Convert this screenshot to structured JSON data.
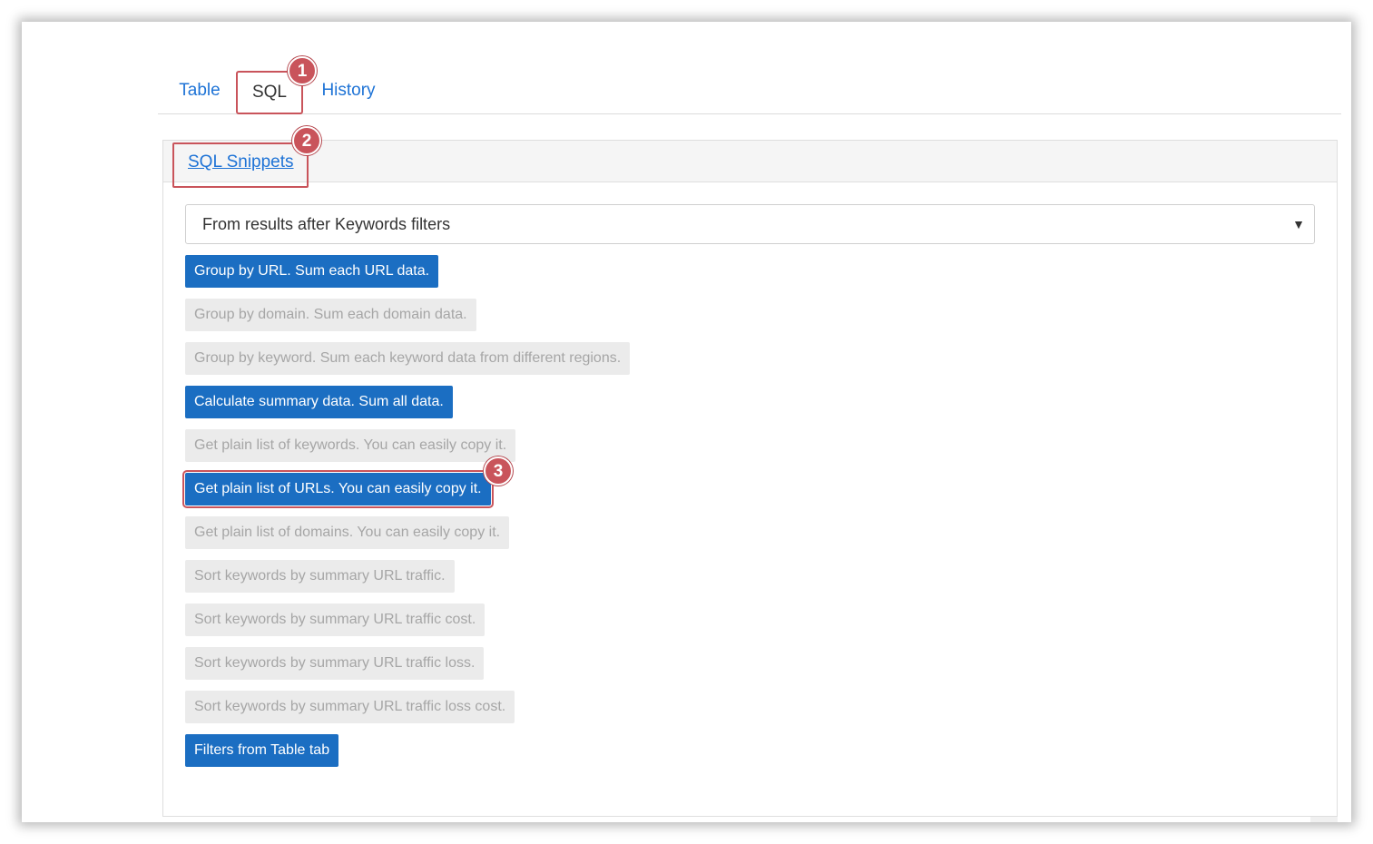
{
  "tabs": {
    "table": "Table",
    "sql": "SQL",
    "history": "History"
  },
  "callouts": {
    "one": "1",
    "two": "2",
    "three": "3"
  },
  "panel": {
    "snippets_link": "SQL Snippets",
    "source_select": {
      "value": "From results after Keywords filters",
      "arrow_icon": "triangle-down-icon"
    }
  },
  "snippets": [
    {
      "label": "Group by URL. Sum each URL data.",
      "state": "active"
    },
    {
      "label": "Group by domain. Sum each domain data.",
      "state": "inactive"
    },
    {
      "label": "Group by keyword. Sum each keyword data from different regions.",
      "state": "inactive"
    },
    {
      "label": "Calculate summary data. Sum all data.",
      "state": "active"
    },
    {
      "label": "Get plain list of keywords. You can easily copy it.",
      "state": "inactive"
    },
    {
      "label": "Get plain list of URLs. You can easily copy it.",
      "state": "active"
    },
    {
      "label": "Get plain list of domains. You can easily copy it.",
      "state": "inactive"
    },
    {
      "label": "Sort keywords by summary URL traffic.",
      "state": "inactive"
    },
    {
      "label": "Sort keywords by summary URL traffic cost.",
      "state": "inactive"
    },
    {
      "label": "Sort keywords by summary URL traffic loss.",
      "state": "inactive"
    },
    {
      "label": "Sort keywords by summary URL traffic loss cost.",
      "state": "inactive"
    },
    {
      "label": "Filters from Table tab",
      "state": "active"
    }
  ],
  "colors": {
    "accent": "#1b6ec2",
    "link": "#1e73d6",
    "callout": "#c9545b",
    "inactive_bg": "#ebebeb",
    "inactive_text": "#a6a6a6"
  }
}
